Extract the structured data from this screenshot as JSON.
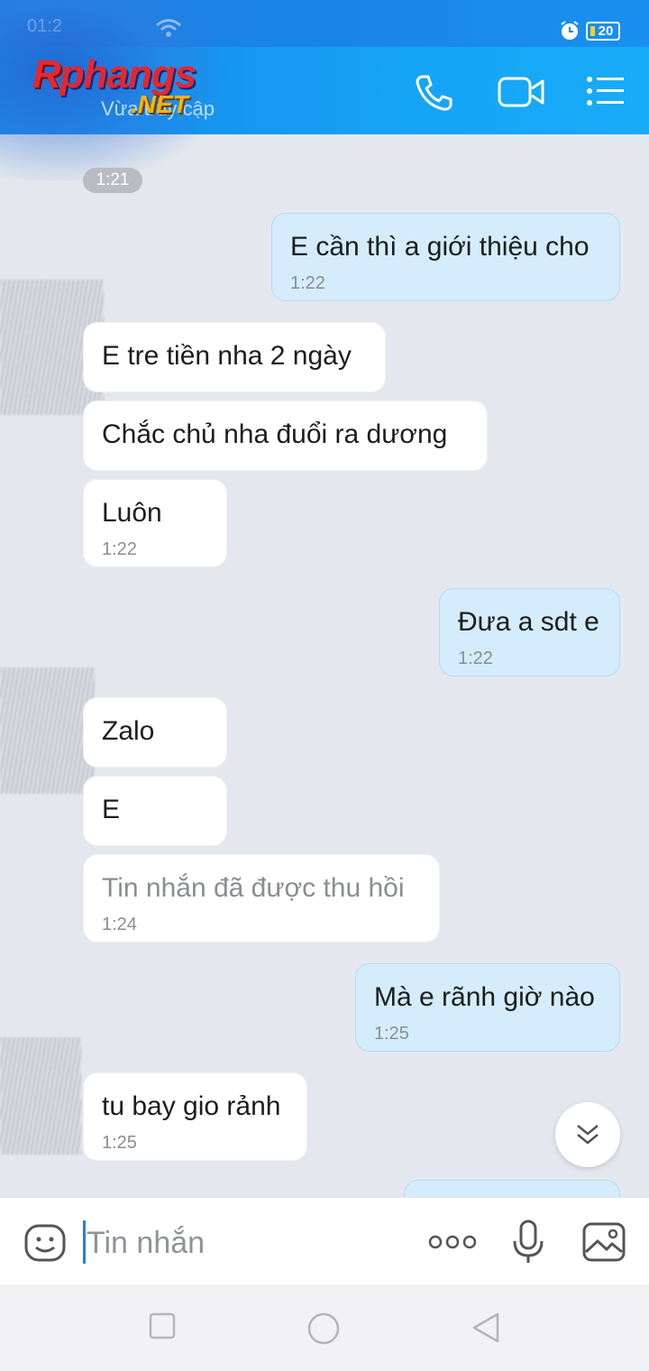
{
  "status_bar": {
    "time": "01:2",
    "battery": "20"
  },
  "header": {
    "logo_r": "R",
    "logo_rest": "phangs",
    "logo_net": ".NET",
    "subtitle": "Vừa truy cập",
    "icons": [
      "phone-icon",
      "video-call-icon",
      "menu-list-icon"
    ]
  },
  "chat": {
    "time_pill": "1:21",
    "messages": [
      {
        "dir": "out",
        "text": "E cần thì a giới thiệu cho",
        "time": "1:22"
      },
      {
        "dir": "in",
        "text": "E tre tiền nha 2 ngày",
        "time": ""
      },
      {
        "dir": "in",
        "text": "Chắc chủ nha đuổi ra dương",
        "time": ""
      },
      {
        "dir": "in",
        "text": "Luôn",
        "time": "1:22"
      },
      {
        "dir": "out",
        "text": "Đưa a sdt e",
        "time": "1:22"
      },
      {
        "dir": "in",
        "text": "Zalo",
        "time": ""
      },
      {
        "dir": "in",
        "text": "E",
        "time": ""
      },
      {
        "dir": "in",
        "text": "Tin nhắn đã được thu hồi",
        "time": "1:24",
        "recalled": true
      },
      {
        "dir": "out",
        "text": "Mà e rãnh giờ nào",
        "time": "1:25"
      },
      {
        "dir": "in",
        "text": "tu bay gio rảnh",
        "time": "1:25"
      }
    ]
  },
  "input": {
    "placeholder": "Tin nhắn",
    "icons": [
      "emoji-icon",
      "more-icon",
      "microphone-icon",
      "image-icon"
    ]
  },
  "nav": {
    "icons": [
      "recent-apps-icon",
      "home-icon",
      "back-icon"
    ]
  },
  "colors": {
    "header": "#16a3f5",
    "out_bubble": "#d4ecfc",
    "in_bubble": "#ffffff",
    "chat_bg": "#e4e8ee"
  }
}
